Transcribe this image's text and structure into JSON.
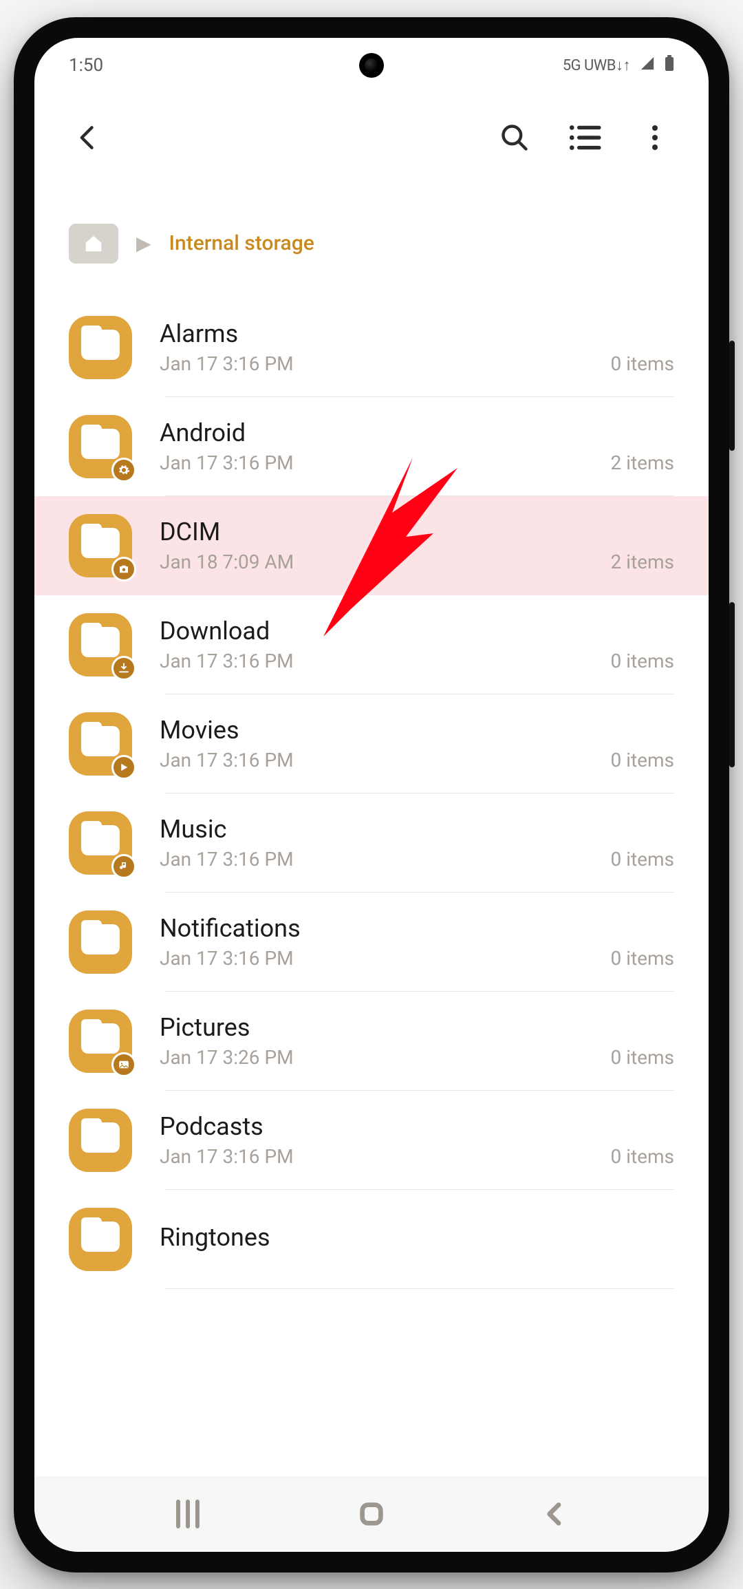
{
  "status": {
    "time": "1:50",
    "network_label": "5G UWB↓↑",
    "signal": "▲",
    "battery": "▮"
  },
  "toolbar": {
    "back_label": "Back",
    "search_label": "Search",
    "view_toggle_label": "List view",
    "more_label": "More options"
  },
  "breadcrumb": {
    "home_label": "Home",
    "current": "Internal storage"
  },
  "folders": [
    {
      "name": "Alarms",
      "date": "Jan 17 3:16 PM",
      "count": "0 items",
      "badge": null,
      "highlight": false
    },
    {
      "name": "Android",
      "date": "Jan 17 3:16 PM",
      "count": "2 items",
      "badge": "gear",
      "highlight": false
    },
    {
      "name": "DCIM",
      "date": "Jan 18 7:09 AM",
      "count": "2 items",
      "badge": "camera",
      "highlight": true
    },
    {
      "name": "Download",
      "date": "Jan 17 3:16 PM",
      "count": "0 items",
      "badge": "download",
      "highlight": false
    },
    {
      "name": "Movies",
      "date": "Jan 17 3:16 PM",
      "count": "0 items",
      "badge": "play",
      "highlight": false
    },
    {
      "name": "Music",
      "date": "Jan 17 3:16 PM",
      "count": "0 items",
      "badge": "music",
      "highlight": false
    },
    {
      "name": "Notifications",
      "date": "Jan 17 3:16 PM",
      "count": "0 items",
      "badge": null,
      "highlight": false
    },
    {
      "name": "Pictures",
      "date": "Jan 17 3:26 PM",
      "count": "0 items",
      "badge": "image",
      "highlight": false
    },
    {
      "name": "Podcasts",
      "date": "Jan 17 3:16 PM",
      "count": "0 items",
      "badge": null,
      "highlight": false
    },
    {
      "name": "Ringtones",
      "date": "",
      "count": "",
      "badge": null,
      "highlight": false
    }
  ],
  "nav": {
    "recent_label": "Recent apps",
    "home_label": "Home",
    "back_label": "Back"
  },
  "annotation": {
    "arrow_points_to": "DCIM"
  }
}
